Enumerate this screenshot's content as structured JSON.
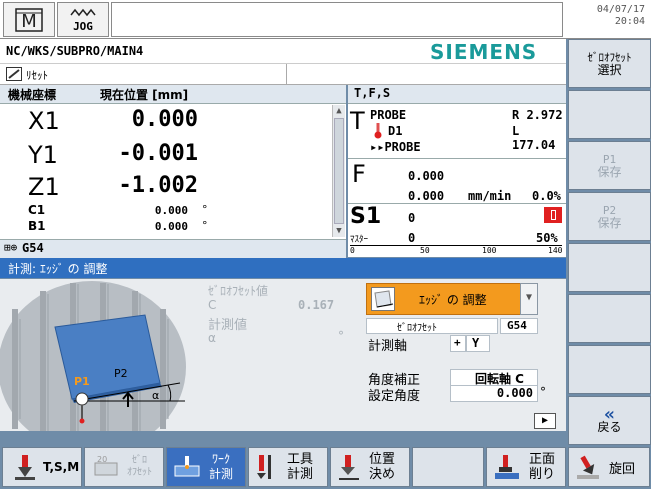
{
  "top": {
    "mode_icon": "machine-icon",
    "jog_label": "JOG",
    "date": "04/07/17",
    "time": "20:04"
  },
  "path": "NC/WKS/SUBPRO/MAIN4",
  "brand": "SIEMENS",
  "status_text": "ﾘｾｯﾄ",
  "axis_panel": {
    "title": "機械座標",
    "position_header": "現在位置 [mm]",
    "axes": [
      {
        "name": "X1",
        "value": "0.000",
        "unit": ""
      },
      {
        "name": "Y1",
        "value": "-0.001",
        "unit": ""
      },
      {
        "name": "Z1",
        "value": "-1.002",
        "unit": ""
      },
      {
        "name": "C1",
        "value": "0.000",
        "unit": "°"
      },
      {
        "name": "B1",
        "value": "0.000",
        "unit": "°"
      }
    ],
    "work_offset": "G54"
  },
  "tfs_panel": {
    "title": "T,F,S",
    "t_letter": "T",
    "tool_name": "PROBE",
    "radius": "R 2.972",
    "edge": "D1",
    "length": "L 177.04",
    "next_tool": "▸▸PROBE",
    "f_letter": "F",
    "f_actual": "0.000",
    "f_set": "0.000",
    "f_unit": "mm/min",
    "f_override": "0.0%",
    "s_letter": "S1",
    "s_actual": "0",
    "s_set": "0",
    "spindle_master": "ﾏｽﾀｰ",
    "spindle_override": "50%",
    "scale_ticks": [
      "0",
      "50",
      "100",
      "140"
    ]
  },
  "measure": {
    "title": "計測: ｴｯｼﾞ の 調整",
    "zero_offset_value_label": "ｾﾞﾛｵﾌｾｯﾄ値",
    "c_label": "C",
    "c_value": "0.167",
    "measured_value_label": "計測値",
    "alpha_label": "α",
    "alpha_unit": "°",
    "dropdown_value": "ｴｯｼﾞ の 調整",
    "zero_offset_label": "ｾﾞﾛｵﾌｾｯﾄ",
    "zero_offset_value": "G54",
    "axis_label": "計測軸",
    "axis_sign": "+",
    "axis_value": "Y",
    "angle_corr_label": "角度補正",
    "angle_corr_value": "回転軸 C",
    "set_angle_label": "設定角度",
    "set_angle_value": "0.000",
    "set_angle_unit": "°",
    "diagram_p1": "P1",
    "diagram_p2": "P2",
    "diagram_alpha": "α"
  },
  "vertical_softkeys": [
    {
      "label1": "ｾﾞﾛｵﾌｾｯﾄ",
      "label2": "選択",
      "enabled": true
    },
    {
      "label1": "",
      "label2": "",
      "enabled": true
    },
    {
      "label1": "P1",
      "label2": "保存",
      "enabled": false
    },
    {
      "label1": "P2",
      "label2": "保存",
      "enabled": false
    },
    {
      "label1": "",
      "label2": "",
      "enabled": true
    },
    {
      "label1": "",
      "label2": "",
      "enabled": true
    },
    {
      "label1": "",
      "label2": "",
      "enabled": true
    },
    {
      "label1": "«",
      "label2": "戻る",
      "enabled": true
    }
  ],
  "horizontal_softkeys": [
    {
      "label": "T,S,M"
    },
    {
      "label1": "ｾﾞﾛ",
      "label2": "ｵﾌｾｯﾄ"
    },
    {
      "label1": "ﾜｰｸ",
      "label2": "計測"
    },
    {
      "label1": "工具",
      "label2": "計測"
    },
    {
      "label1": "位置",
      "label2": "決め"
    },
    {
      "label": ""
    },
    {
      "label1": "正面",
      "label2": "削り"
    },
    {
      "label": "旋回"
    }
  ],
  "colors": {
    "background": "#6f8ca8",
    "selection_bar": "#2f6fc0",
    "siemens_teal": "#1a9a9a",
    "orange": "#f39a1e",
    "spindle_red": "#e02020"
  }
}
